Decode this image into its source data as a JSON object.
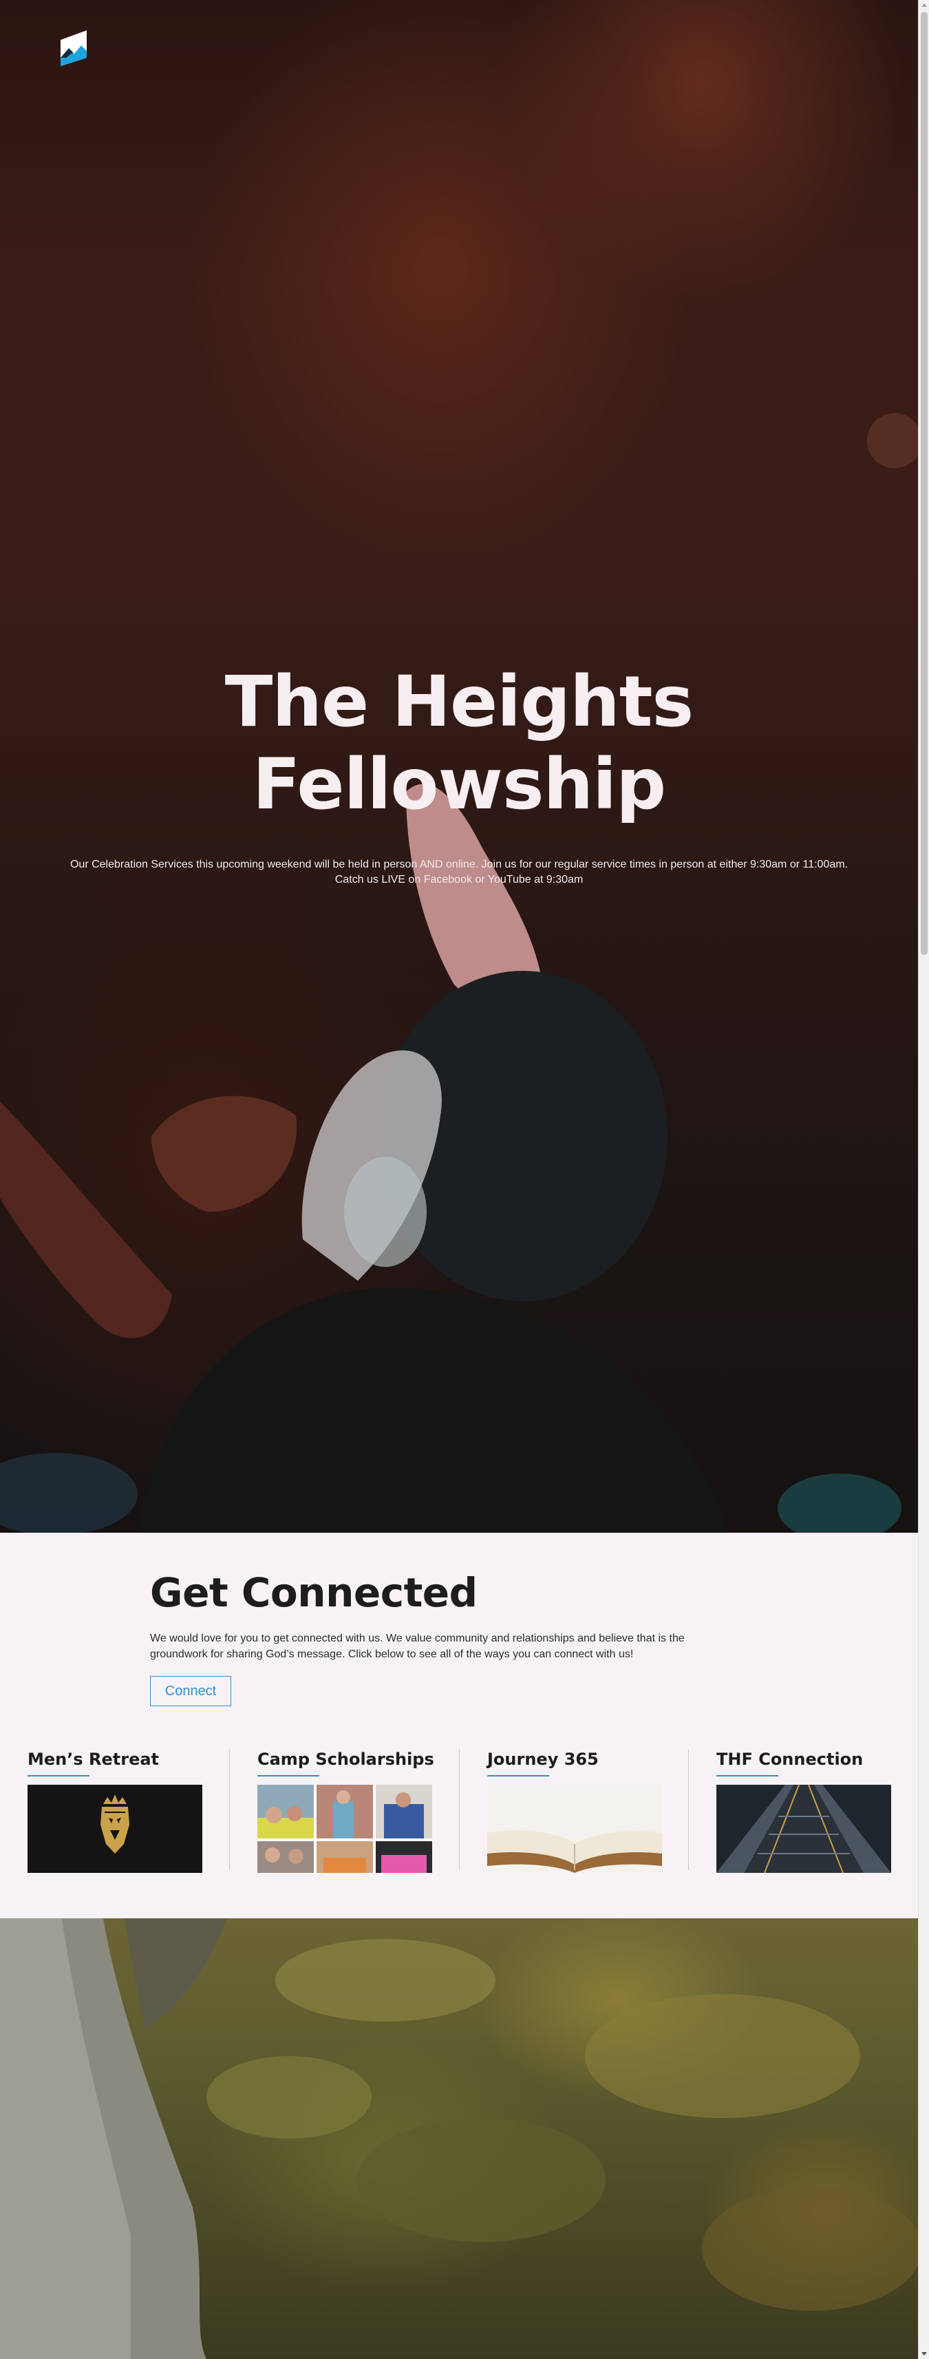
{
  "hero": {
    "title_line1": "The Heights",
    "title_line2": "Fellowship",
    "description": "Our Celebration Services this upcoming weekend will be held in person AND online. Join us for our regular service times in person at either 9:30am or 11:00am. Catch us LIVE on Facebook or YouTube at 9:30am"
  },
  "connect": {
    "title": "Get Connected",
    "text": "We would love for you to get connected with us. We value community and relationships and believe that is the groundwork for sharing God’s message. Click below to see all of the ways you can connect with us!",
    "button_label": "Connect",
    "cards": [
      {
        "title": "Men’s Retreat"
      },
      {
        "title": "Camp Scholarships"
      },
      {
        "title": "Journey 365"
      },
      {
        "title": "THF Connection"
      }
    ]
  },
  "colors": {
    "accent": "#2f8fd1",
    "logo_blue": "#1fa3df",
    "text_dark": "#1d1d1f",
    "section_bg": "#f7f2f5"
  },
  "icons": {
    "logo": "mountain-logo-icon",
    "retreat_emblem": "lion-crown-emblem-icon"
  }
}
